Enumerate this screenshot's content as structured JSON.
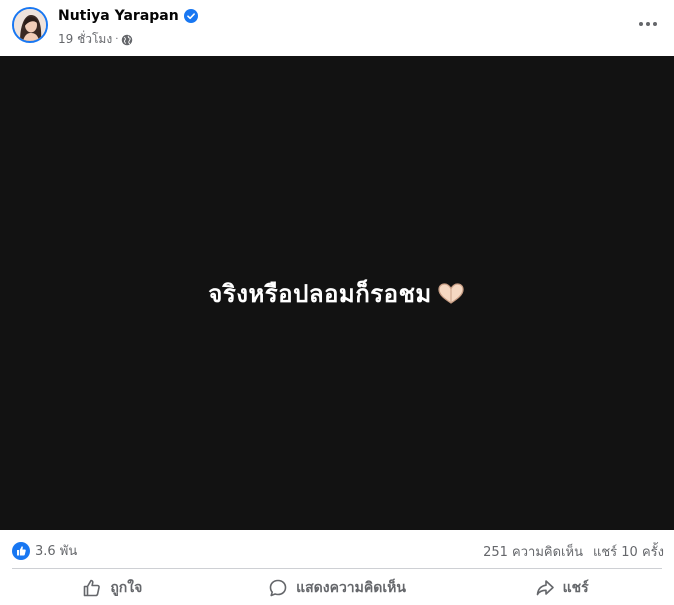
{
  "post": {
    "author": "Nutiya Yarapan",
    "timestamp": "19 ชั่วโมง",
    "meta_separator": "·",
    "icons": {
      "verified": "verified-badge-icon",
      "audience": "globe-icon",
      "more": "more-options-icon"
    },
    "media_text": "จริงหรือปลอมก็รอชม",
    "media_emoji": "heart-hands-emoji",
    "colors": {
      "media_bg": "#121212",
      "accent": "#1877f2",
      "secondary_text": "#65676b"
    }
  },
  "stats": {
    "reactions_count": "3.6 พัน",
    "comments": "251 ความคิดเห็น",
    "shares": "แชร์ 10 ครั้ง"
  },
  "actions": {
    "like_label": "ถูกใจ",
    "comment_label": "แสดงความคิดเห็น",
    "share_label": "แชร์"
  }
}
